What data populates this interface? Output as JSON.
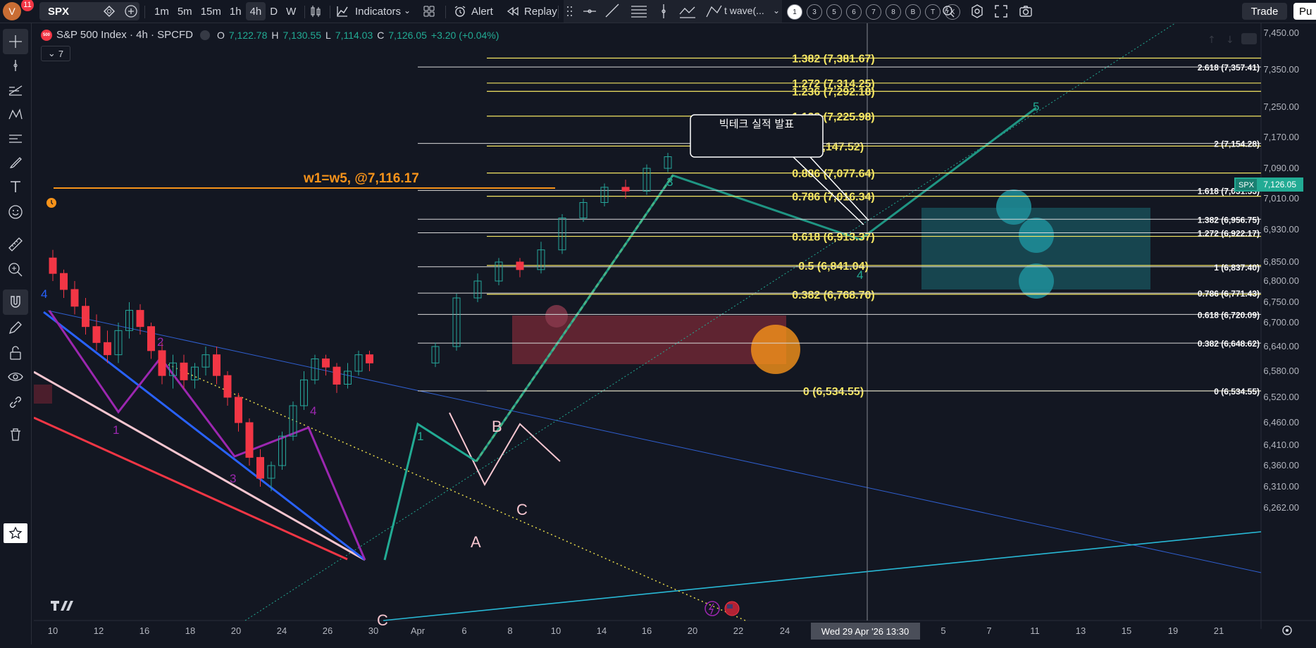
{
  "header": {
    "user_initial": "V",
    "notification_count": "11",
    "symbol": "SPX",
    "timeframes": [
      "1m",
      "5m",
      "15m",
      "1h",
      "4h",
      "D",
      "W"
    ],
    "active_timeframe": "4h",
    "indicators_label": "Indicators",
    "alert_label": "Alert",
    "replay_label": "Replay",
    "template_label": "t wave(...",
    "number_buttons": [
      "1",
      "3",
      "5",
      "6",
      "7",
      "8",
      "B",
      "T",
      "X"
    ],
    "trade_label": "Trade",
    "publish_label": "Pu"
  },
  "legend": {
    "title": "S&P 500 Index · 4h · SPCFD",
    "o_label": "O",
    "o": "7,122.78",
    "h_label": "H",
    "h": "7,130.55",
    "l_label": "L",
    "l": "7,114.03",
    "c_label": "C",
    "c": "7,126.05",
    "change": "+3.20 (+0.04%)",
    "indicator_count": "7",
    "badge_500": "500"
  },
  "chart_data": {
    "type": "candlestick",
    "symbol": "SPX",
    "interval": "4h",
    "last_price": "7,126.05",
    "price_axis_labels": [
      "7,450.00",
      "7,350.00",
      "7,250.00",
      "7,170.00",
      "7,090.00",
      "7,010.00",
      "6,930.00",
      "6,850.00",
      "6,800.00",
      "6,750.00",
      "6,700.00",
      "6,640.00",
      "6,580.00",
      "6,520.00",
      "6,460.00",
      "6,410.00",
      "6,360.00",
      "6,310.00",
      "6,262.00"
    ],
    "time_axis_labels": [
      "10",
      "12",
      "16",
      "18",
      "20",
      "24",
      "26",
      "30",
      "Apr",
      "6",
      "8",
      "10",
      "14",
      "16",
      "20",
      "22",
      "24",
      "5",
      "7",
      "11",
      "13",
      "15",
      "19",
      "21"
    ],
    "crosshair_time": "Wed 29 Apr '26   13:30",
    "fib_retracement": [
      {
        "level": "1.382 (7,381.67)",
        "price": 7381.67
      },
      {
        "level": "1.272 (7,314.25)",
        "price": 7314.25
      },
      {
        "level": "1.236 (7,292.18)",
        "price": 7292.18
      },
      {
        "level": "1.128 (7,225.98)",
        "price": 7225.98
      },
      {
        "level": "1 (7,147.52)",
        "price": 7147.52
      },
      {
        "level": "0.886 (7,077.64)",
        "price": 7077.64
      },
      {
        "level": "0.786 (7,016.34)",
        "price": 7016.34
      },
      {
        "level": "0.618 (6,913.37)",
        "price": 6913.37
      },
      {
        "level": "0.5 (6,841.04)",
        "price": 6841.04
      },
      {
        "level": "0.382 (6,768.70)",
        "price": 6768.7
      },
      {
        "level": "0 (6,534.55)",
        "price": 6534.55
      }
    ],
    "fib_extension": [
      {
        "level": "2.618 (7,357.41)",
        "price": 7357.41
      },
      {
        "level": "2 (7,154.28)",
        "price": 7154.28
      },
      {
        "level": "1.618 (7,031.53)",
        "price": 7031.53
      },
      {
        "level": "1.382 (6,956.75)",
        "price": 6956.75
      },
      {
        "level": "1.272 (6,922.17)",
        "price": 6922.17
      },
      {
        "level": "1 (6,837.40)",
        "price": 6837.4
      },
      {
        "level": "0.786 (6,771.43)",
        "price": 6771.43
      },
      {
        "level": "0.618 (6,720.09)",
        "price": 6720.09
      },
      {
        "level": "0.382 (6,648.62)",
        "price": 6648.62
      },
      {
        "level": "0 (6,534.55)",
        "price": 6534.55
      }
    ],
    "annotations": {
      "w1w5": "w1=w5, @7,116.17",
      "callout": "빅테크 실적 발표",
      "wave_labels": [
        "4",
        "2",
        "1",
        "3",
        "4",
        "C",
        "1",
        "A",
        "B",
        "C",
        "3",
        "4",
        "5"
      ]
    },
    "colors": {
      "up": "#26a69a",
      "down": "#f23645",
      "fib": "#f5e663",
      "orange": "#f7931a",
      "wave_green": "#22ab94",
      "background": "#131722"
    }
  }
}
